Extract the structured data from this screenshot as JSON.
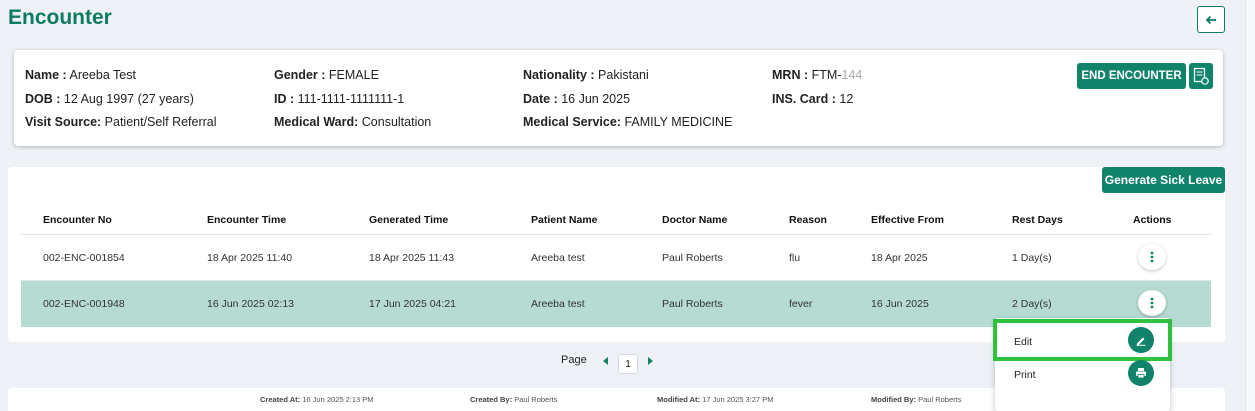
{
  "page": {
    "title": "Encounter"
  },
  "patient": {
    "name_label": "Name :",
    "name": "Areeba Test",
    "dob_label": "DOB :",
    "dob": "12 Aug 1997 (27 years)",
    "visit_source_label": "Visit Source:",
    "visit_source": "Patient/Self Referral",
    "gender_label": "Gender :",
    "gender": "FEMALE",
    "id_label": "ID :",
    "id": "111-1111-1111111-1",
    "ward_label": "Medical Ward:",
    "ward": "Consultation",
    "nationality_label": "Nationality :",
    "nationality": "Pakistani",
    "date_label": "Date :",
    "date": "16 Jun 2025",
    "service_label": "Medical Service:",
    "service": "FAMILY MEDICINE",
    "mrn_label": "MRN :",
    "mrn_prefix": "FTM-",
    "mrn_suffix": "144",
    "ins_label": "INS. Card :",
    "ins": "12"
  },
  "actions": {
    "end_encounter": "END ENCOUNTER",
    "generate_sick_leave": "Generate Sick Leave"
  },
  "table": {
    "headers": [
      "Encounter No",
      "Encounter Time",
      "Generated Time",
      "Patient Name",
      "Doctor Name",
      "Reason",
      "Effective From",
      "Rest Days",
      "Actions"
    ],
    "rows": [
      [
        "002-ENC-001854",
        "18 Apr 2025 11:40",
        "18 Apr 2025 11:43",
        "Areeba test",
        "Paul Roberts",
        "flu",
        "18 Apr 2025",
        "1 Day(s)"
      ],
      [
        "002-ENC-001948",
        "16 Jun 2025 02:13",
        "17 Jun 2025 04:21",
        "Areeba test",
        "Paul Roberts",
        "fever",
        "16 Jun 2025",
        "2 Day(s)"
      ]
    ]
  },
  "menu": {
    "edit": "Edit",
    "print": "Print"
  },
  "pagination": {
    "label": "Page",
    "current": "1"
  },
  "footer": {
    "created_at_label": "Created At:",
    "created_at": "16 Jun 2025 2:13 PM",
    "created_by_label": "Created By:",
    "created_by": "Paul Roberts",
    "modified_at_label": "Modified At:",
    "modified_at": "17 Jun 2025 3:27 PM",
    "modified_by_label": "Modified By:",
    "modified_by": "Paul Roberts"
  },
  "colors": {
    "primary": "#11836b",
    "selected_row": "#b5dbd2",
    "highlight": "#2fc13c"
  }
}
